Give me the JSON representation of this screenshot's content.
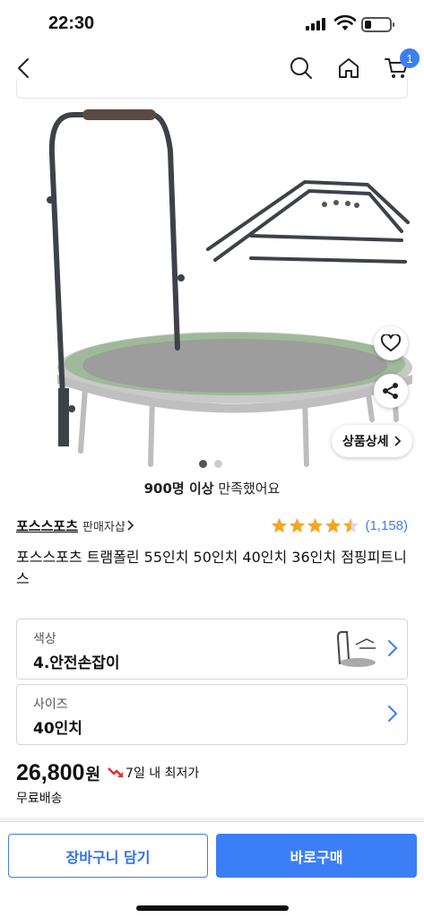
{
  "status_bar": {
    "time": "22:30"
  },
  "header": {
    "cart_count": "1"
  },
  "product_image": {
    "page_count": 2,
    "active_index": 0,
    "detail_label": "상품상세"
  },
  "satisfaction": {
    "count": "900명 이상",
    "text": "만족했어요"
  },
  "seller": {
    "name": "포스스포츠",
    "tag": "판매자샵"
  },
  "rating": {
    "stars": 4.5,
    "count": "(1,158)"
  },
  "product_title": "포스스포츠 트램폴린 55인치 50인치 40인치 36인치 점핑피트니스",
  "options": [
    {
      "label": "색상",
      "value": "4.안전손잡이"
    },
    {
      "label": "사이즈",
      "value": "40인치"
    }
  ],
  "price": {
    "amount": "26,800",
    "unit": "원",
    "lowest_badge": "7일 내 최저가",
    "shipping": "무료배송"
  },
  "buttons": {
    "cart": "장바구니 담기",
    "buy": "바로구매"
  },
  "colors": {
    "accent": "#3b7ef6",
    "star": "#f5a623",
    "lowest_arrow": "#e8312f"
  }
}
